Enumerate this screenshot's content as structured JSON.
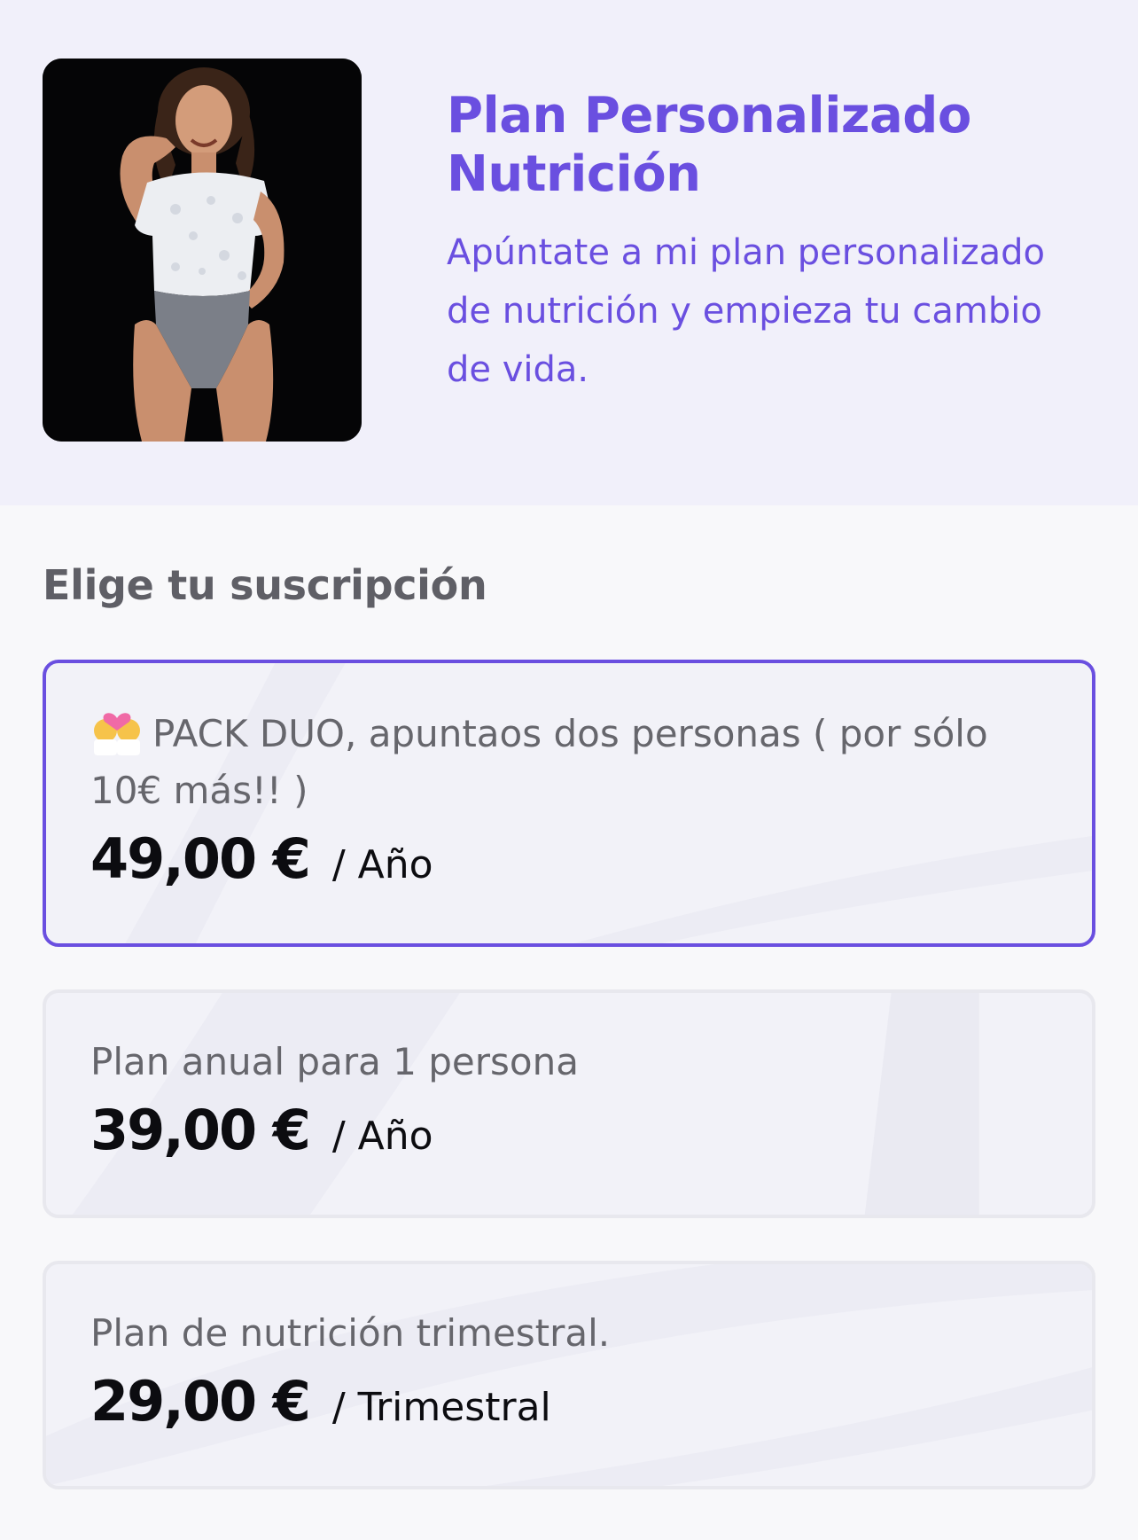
{
  "hero": {
    "title_line1": "Plan Personalizado",
    "title_line2": "Nutrición",
    "description": "Apúntate a mi plan personalizado de nutrición y empieza tu cambio de vida.",
    "photo_icon": "trainer-photo"
  },
  "subscriptions": {
    "heading": "Elige tu suscripción",
    "plans": [
      {
        "icon": "couple-with-heart-emoji",
        "name": "PACK DUO, apuntaos dos personas ( por sólo 10€ más!! )",
        "price": "49,00 €",
        "period": "/ Año",
        "selected": true
      },
      {
        "name": "Plan anual para 1 persona",
        "price": "39,00 €",
        "period": "/ Año",
        "selected": false
      },
      {
        "name": "Plan de nutrición trimestral.",
        "price": "29,00 €",
        "period": "/ Trimestral",
        "selected": false
      }
    ]
  },
  "colors": {
    "accent": "#6a4fe0",
    "hero_background": "#f1f0fa",
    "page_background": "#f8f8fa",
    "card_background": "#f2f2f8"
  }
}
